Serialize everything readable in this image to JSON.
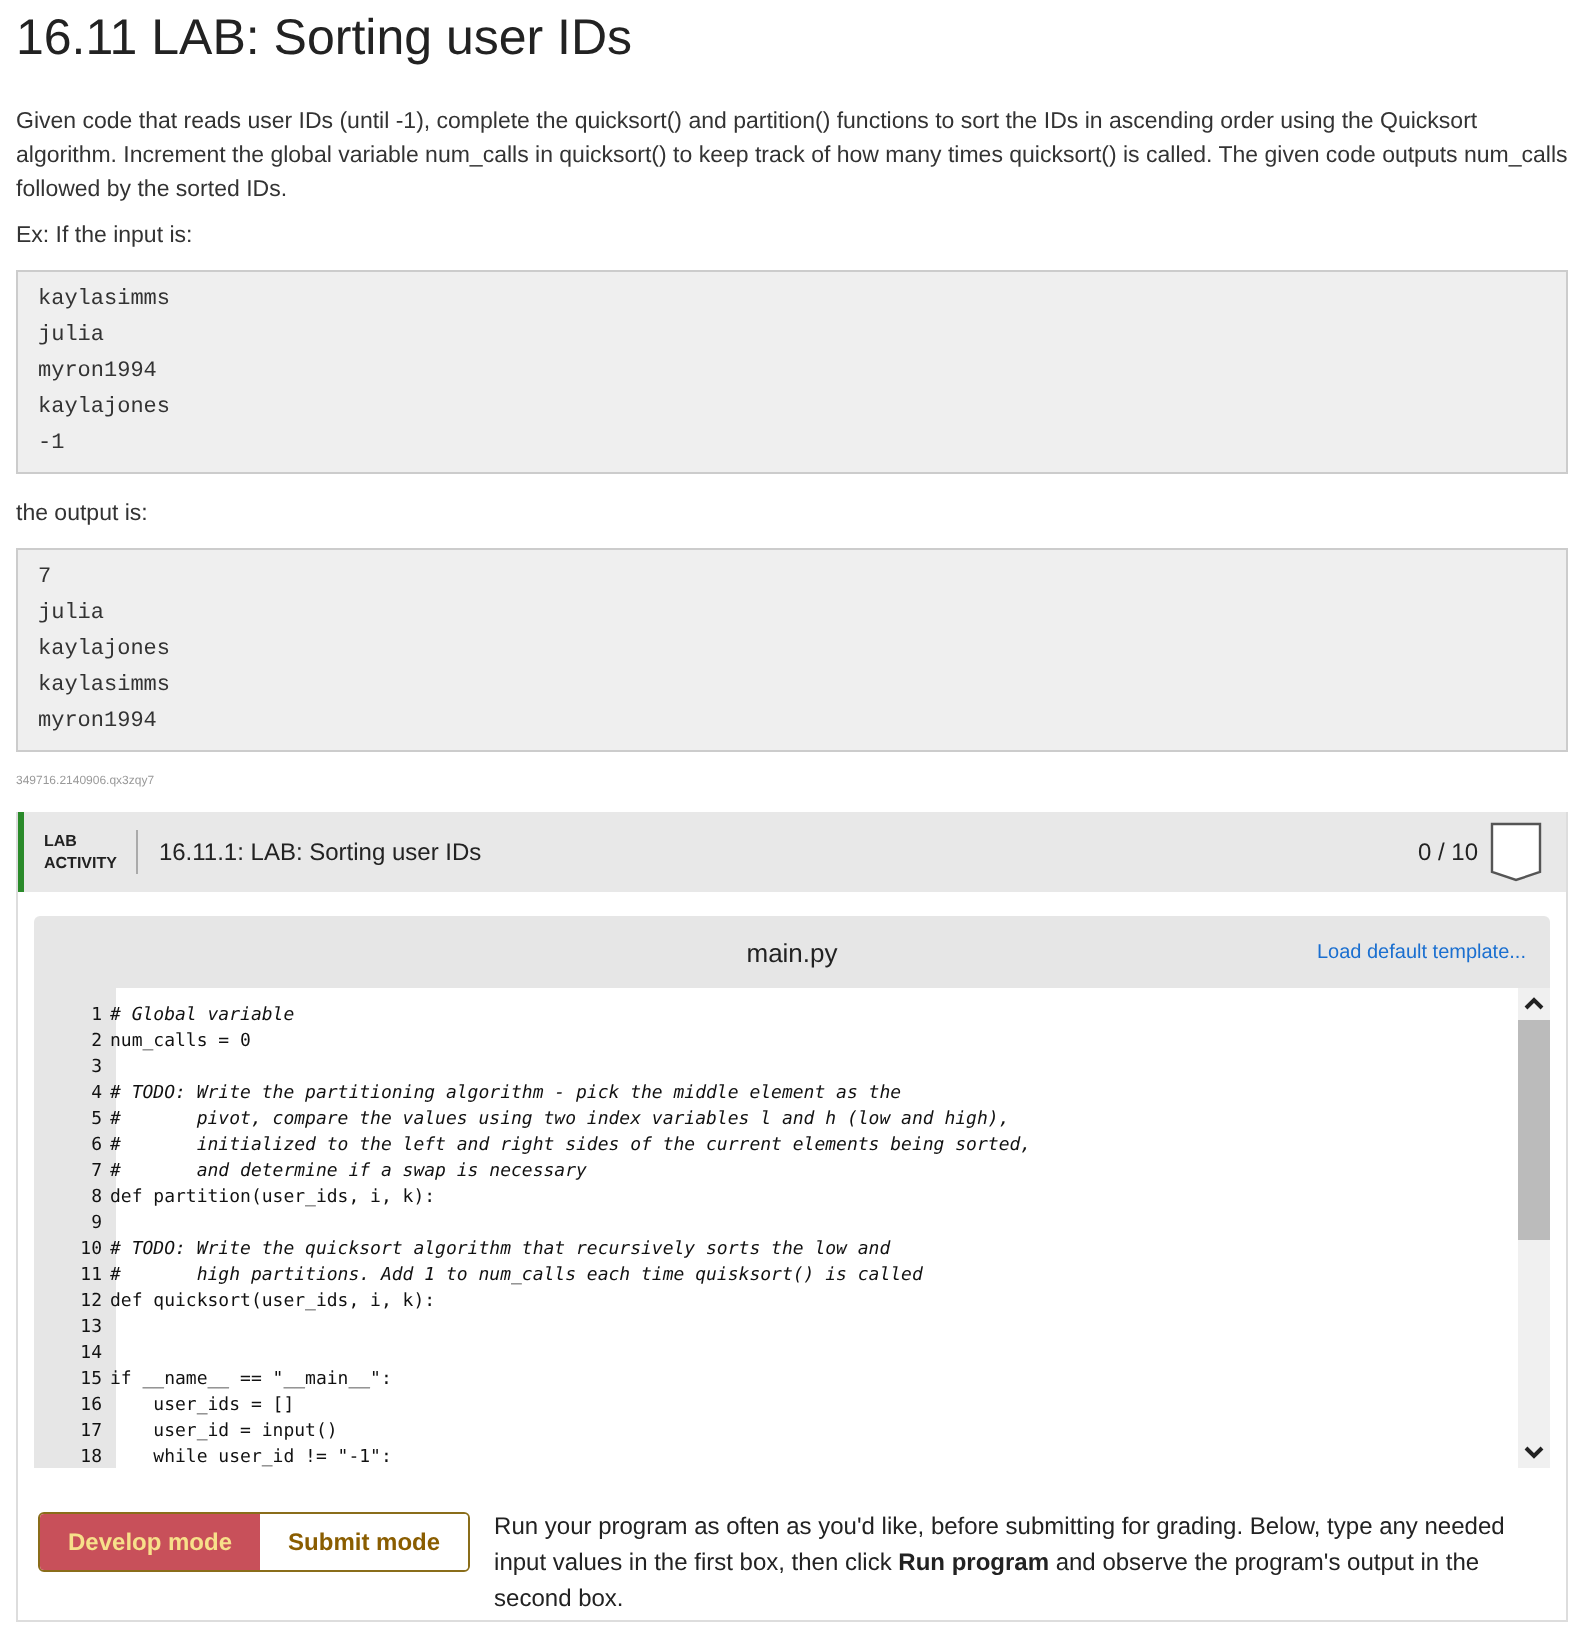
{
  "title": "16.11 LAB: Sorting user IDs",
  "intro": "Given code that reads user IDs (until -1), complete the quicksort() and partition() functions to sort the IDs in ascending order using the Quicksort algorithm. Increment the global variable num_calls in quicksort() to keep track of how many times quicksort() is called. The given code outputs num_calls followed by the sorted IDs.",
  "example_label": "Ex: If the input is:",
  "input_sample": [
    "kaylasimms",
    "julia",
    "myron1994",
    "kaylajones",
    "-1"
  ],
  "output_label": "the output is:",
  "output_sample": [
    "7",
    "julia",
    "kaylajones",
    "kaylasimms",
    "myron1994"
  ],
  "reference_id": "349716.2140906.qx3zqy7",
  "lab": {
    "tag_lines": [
      "LAB",
      "ACTIVITY"
    ],
    "title": "16.11.1: LAB: Sorting user IDs",
    "score": "0 / 10",
    "editor": {
      "filename": "main.py",
      "load_link": "Load default template...",
      "lines": [
        {
          "number": "1",
          "kind": "comment",
          "text": "# Global variable"
        },
        {
          "number": "2",
          "kind": "code",
          "text": "num_calls = 0"
        },
        {
          "number": "3",
          "kind": "blank"
        },
        {
          "number": "4",
          "kind": "comment",
          "text": "# TODO: Write the partitioning algorithm - pick the middle element as the"
        },
        {
          "number": "5",
          "kind": "comment",
          "text": "#       pivot, compare the values using two index variables l and h (low and high),"
        },
        {
          "number": "6",
          "kind": "comment",
          "text": "#       initialized to the left and right sides of the current elements being sorted,"
        },
        {
          "number": "7",
          "kind": "comment",
          "text": "#       and determine if a swap is necessary"
        },
        {
          "number": "8",
          "kind": "code",
          "text": "def partition(user_ids, i, k):"
        },
        {
          "number": "9",
          "kind": "blank"
        },
        {
          "number": "10",
          "kind": "comment",
          "text": "# TODO: Write the quicksort algorithm that recursively sorts the low and"
        },
        {
          "number": "11",
          "kind": "comment",
          "text": "#       high partitions. Add 1 to num_calls each time quisksort() is called"
        },
        {
          "number": "12",
          "kind": "code",
          "text": "def quicksort(user_ids, i, k):"
        },
        {
          "number": "13",
          "kind": "blank"
        },
        {
          "number": "14",
          "kind": "blank"
        },
        {
          "number": "15",
          "kind": "code",
          "text": "if __name__ == \"__main__\":"
        },
        {
          "number": "16",
          "kind": "code",
          "text": "    user_ids = []"
        },
        {
          "number": "17",
          "kind": "code",
          "text": "    user_id = input()"
        },
        {
          "number": "18",
          "kind": "code",
          "text": "    while user_id != \"-1\":"
        }
      ]
    },
    "modes": [
      {
        "label": "Develop mode",
        "selected": true
      },
      {
        "label": "Submit mode",
        "selected": false
      }
    ],
    "instructions": "Run your program as often as you'd like, before submitting for grading. Below, type any needed input values in the first box, then click **Run program** and observe the program's output in the second box."
  }
}
